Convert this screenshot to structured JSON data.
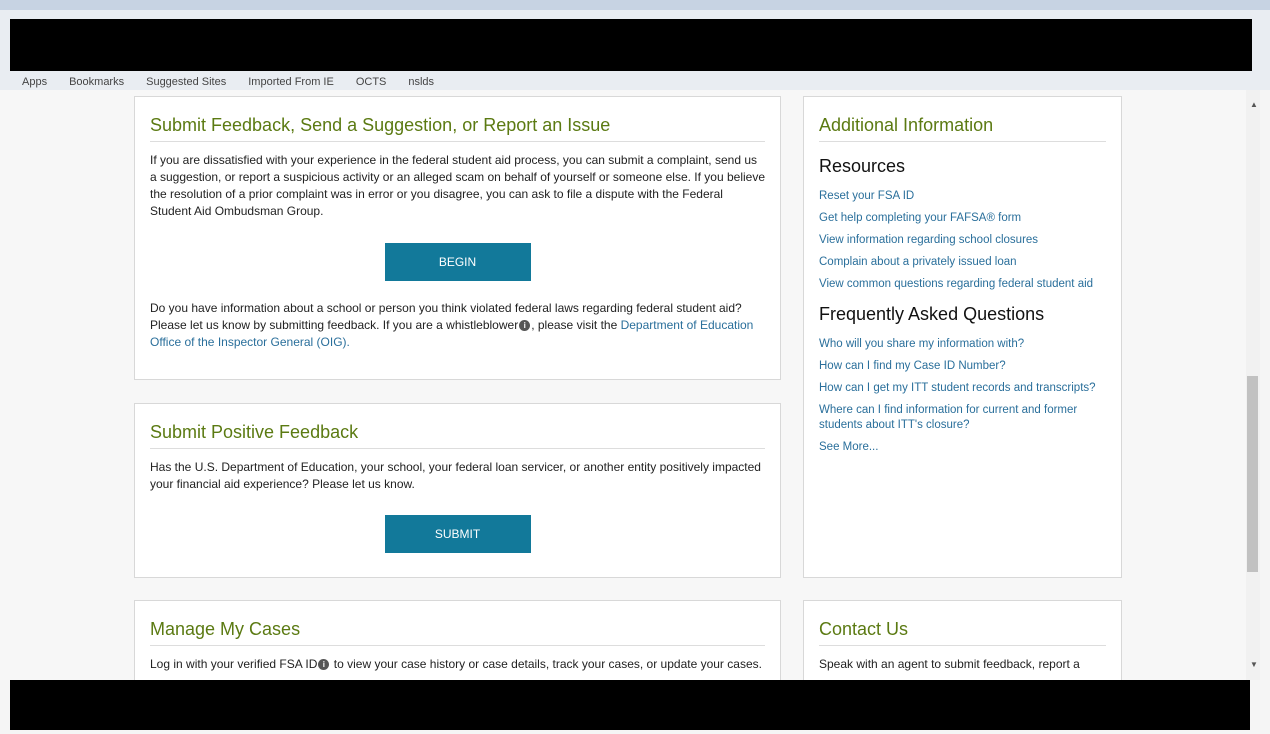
{
  "bookmarks": [
    "Apps",
    "Bookmarks",
    "Suggested Sites",
    "Imported From IE",
    "OCTS",
    "nslds"
  ],
  "feedback": {
    "title": "Submit Feedback, Send a Suggestion, or Report an Issue",
    "body": "If you are dissatisfied with your experience in the federal student aid process, you can submit a complaint, send us a suggestion, or report a suspicious activity or an alleged scam on behalf of yourself or someone else. If you believe the resolution of a prior complaint was in error or you disagree, you can ask to file a dispute with the Federal Student Aid Ombudsman Group.",
    "button": "BEGIN",
    "whistle_text_1": "Do you have information about a school or person you think violated federal laws regarding federal student aid? Please let us know by submitting feedback. If you are a whistleblower",
    "whistle_text_2": ", please visit the ",
    "oig_link": "Department of Education Office of the Inspector General (OIG)",
    "whistle_text_3": "."
  },
  "positive": {
    "title": "Submit Positive Feedback",
    "body": "Has the U.S. Department of Education, your school, your federal loan servicer, or another entity positively impacted your financial aid experience? Please let us know.",
    "button": "SUBMIT"
  },
  "cases": {
    "title": "Manage My Cases",
    "body_1": "Log in with your verified FSA ID",
    "body_2": " to view your case history or case details, track your cases, or update your cases."
  },
  "info": {
    "title": "Additional Information",
    "resources_heading": "Resources",
    "resources": [
      "Reset your FSA ID",
      "Get help completing your FAFSA® form",
      "View information regarding school closures",
      "Complain about a privately issued loan",
      "View common questions regarding federal student aid"
    ],
    "faq_heading": "Frequently Asked Questions",
    "faq": [
      "Who will you share my information with?",
      "How can I find my Case ID Number?",
      "How can I get my ITT student records and transcripts?",
      "Where can I find information for current and former students about ITT's closure?",
      "See More..."
    ]
  },
  "contact": {
    "title": "Contact Us",
    "body": "Speak with an agent to submit feedback, report a"
  }
}
